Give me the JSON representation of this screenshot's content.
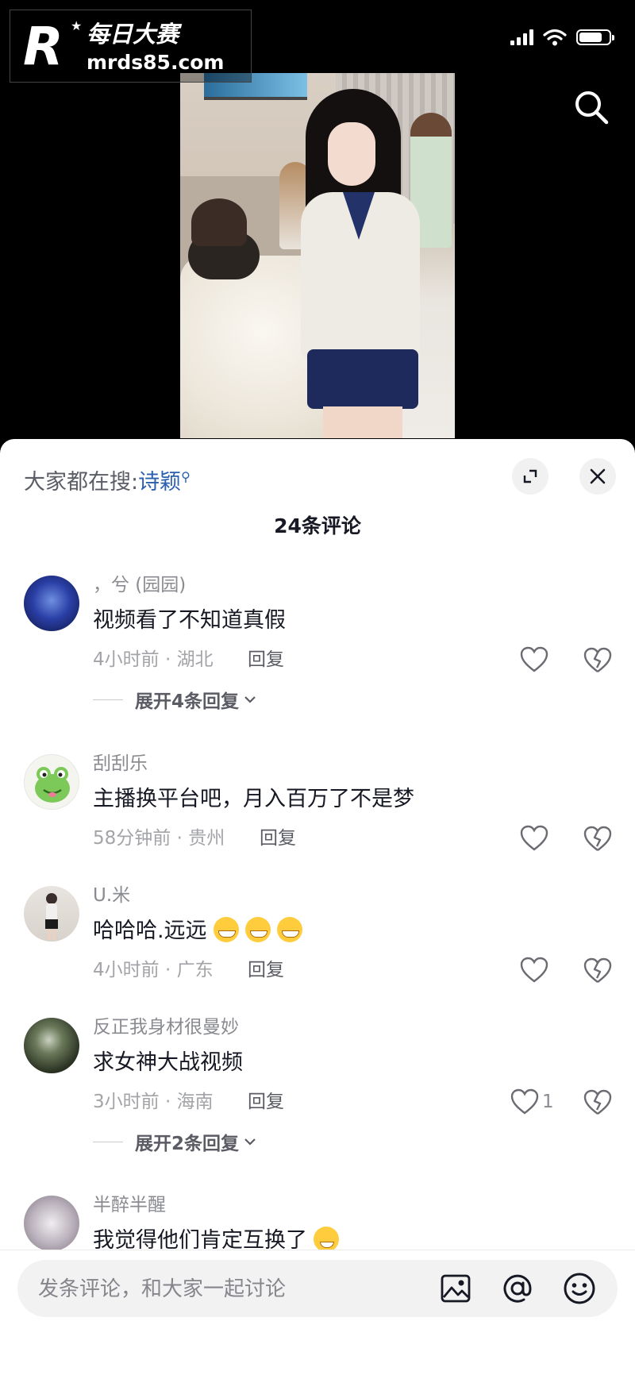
{
  "watermark": {
    "logo_letter": "R",
    "title": "每日大赛",
    "url": "mrds85.com"
  },
  "header": {
    "trending_prefix": "大家都在搜:",
    "trending_keyword": "诗颖"
  },
  "comments_count": "24条评论",
  "comments": [
    {
      "user": "，兮 (园园)",
      "text": "视频看了不知道真假",
      "meta": "4小时前 · 湖北",
      "reply": "回复",
      "likes": "",
      "expand": "展开4条回复"
    },
    {
      "user": "刮刮乐",
      "text": "主播换平台吧，月入百万了不是梦",
      "meta": "58分钟前 · 贵州",
      "reply": "回复",
      "likes": ""
    },
    {
      "user": "U.米",
      "text": "哈哈哈.远远",
      "meta": "4小时前 · 广东",
      "reply": "回复",
      "likes": ""
    },
    {
      "user": "反正我身材很曼妙",
      "text": "求女神大战视频",
      "meta": "3小时前 · 海南",
      "reply": "回复",
      "likes": "1",
      "expand": "展开2条回复"
    },
    {
      "user": "半醉半醒",
      "text": "我觉得他们肯定互换了",
      "meta": "",
      "reply": "",
      "likes": ""
    }
  ],
  "input": {
    "placeholder": "发条评论，和大家一起讨论"
  },
  "icons": {
    "top_right": "search-icon",
    "panel": [
      "expand-icon",
      "close-icon"
    ],
    "comment_actions": [
      "heart-icon",
      "dislike-heart-icon",
      "chevron-down-icon"
    ],
    "emoji": [
      "grin-emoji",
      "cry-laugh-emoji"
    ],
    "input_bar": [
      "image-icon",
      "at-icon",
      "smiley-icon"
    ]
  },
  "colors": {
    "keyword_link": "#2a5fb0",
    "panel_bg": "#ffffff",
    "screen_bg": "#000000"
  }
}
